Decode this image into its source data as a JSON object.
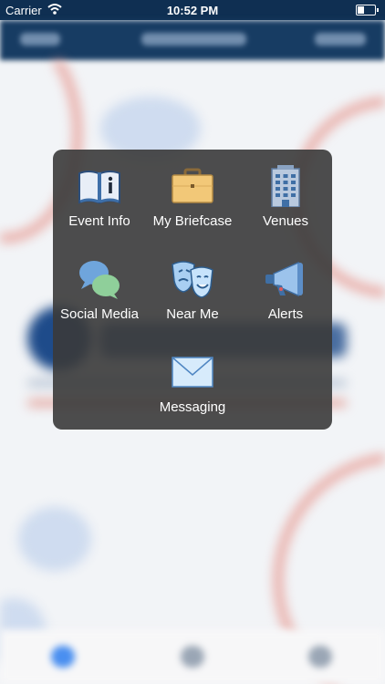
{
  "status": {
    "carrier": "Carrier",
    "time": "10:52 PM"
  },
  "menu": {
    "items": [
      {
        "label": "Event Info",
        "icon": "open-book-info-icon"
      },
      {
        "label": "My Briefcase",
        "icon": "briefcase-icon"
      },
      {
        "label": "Venues",
        "icon": "office-building-icon"
      },
      {
        "label": "Social Media",
        "icon": "speech-bubbles-icon"
      },
      {
        "label": "Near Me",
        "icon": "theater-masks-icon"
      },
      {
        "label": "Alerts",
        "icon": "megaphone-icon"
      },
      {
        "label": "Messaging",
        "icon": "envelope-icon"
      }
    ]
  },
  "colors": {
    "nav": "#173c63",
    "overlay": "#3a3a3a",
    "accent_blue": "#1e4b8a",
    "accent_red": "#e68a80"
  }
}
